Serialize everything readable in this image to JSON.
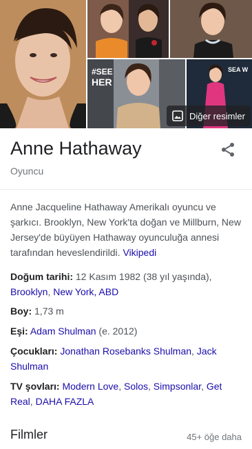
{
  "image_grid": {
    "more_images_label": "Diğer resimler"
  },
  "entity": {
    "name": "Anne Hathaway",
    "type": "Oyuncu"
  },
  "description": {
    "text": "Anne Jacqueline Hathaway Amerikalı oyuncu ve şarkıcı. Brooklyn, New York'ta doğan ve Millburn, New Jersey'de büyüyen Hathaway oyunculuğa annesi tarafından heveslendirildi.",
    "source_link": "Vikipedi"
  },
  "facts": {
    "birth": {
      "label": "Doğum tarihi:",
      "value": "12 Kasım 1982 (38 yıl yaşında),",
      "place_link_1": "Brooklyn",
      "separator": ",",
      "place_link_2": "New York, ABD"
    },
    "height": {
      "label": "Boy:",
      "value": "1,73 m"
    },
    "spouse": {
      "label": "Eşi:",
      "link": "Adam Shulman",
      "suffix": "(e. 2012)"
    },
    "children": {
      "label": "Çocukları:",
      "link_1": "Jonathan Rosebanks Shulman",
      "separator": ",",
      "link_2": "Jack Shulman"
    },
    "tv": {
      "label": "TV şovları:",
      "links": [
        "Modern Love",
        "Solos",
        "Simpsonlar",
        "Get Real"
      ],
      "more_link": "DAHA FAZLA"
    }
  },
  "films": {
    "heading": "Filmler",
    "count_link": "45+ öğe daha"
  },
  "colors": {
    "link": "#1a0dab",
    "text": "#202124",
    "muted": "#70757a"
  }
}
